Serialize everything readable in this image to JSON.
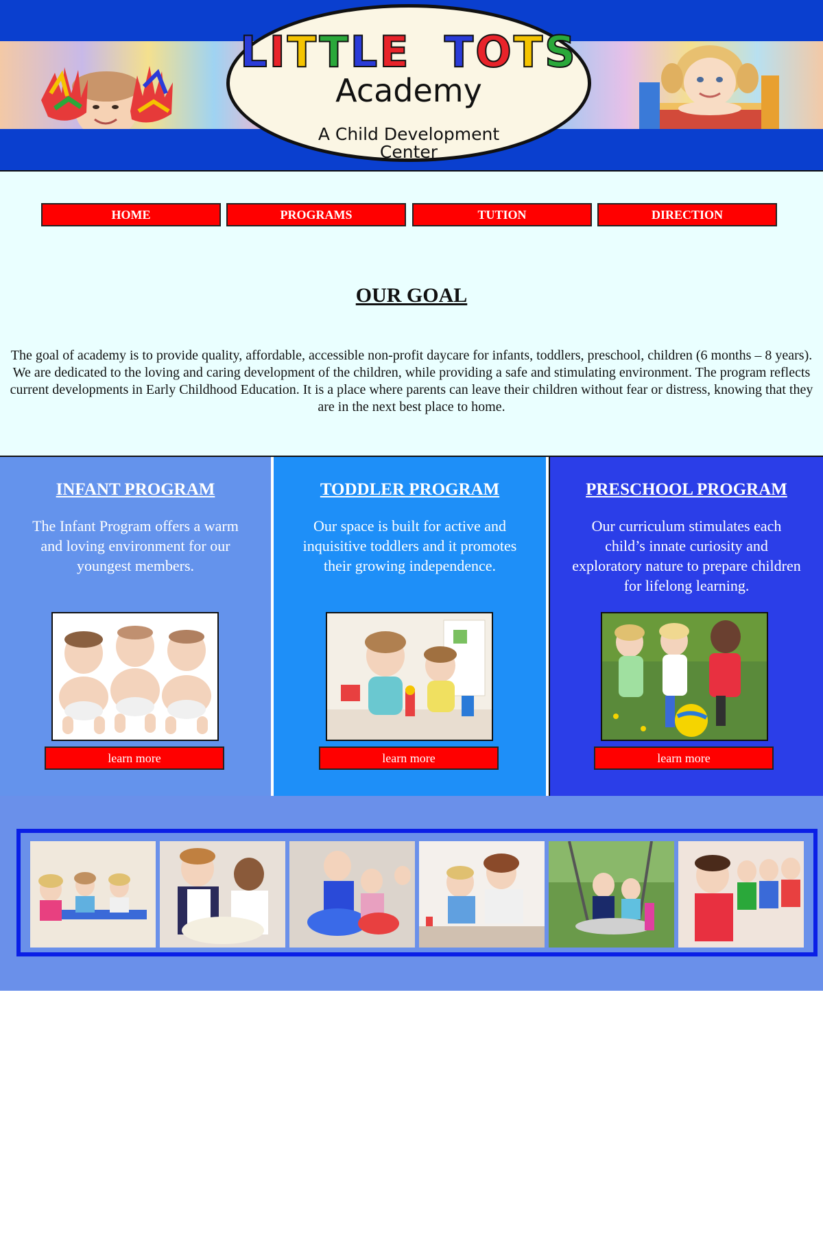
{
  "header": {
    "logo": {
      "title_letters": [
        {
          "char": "L",
          "color": "#2a3bd8"
        },
        {
          "char": "I",
          "color": "#e8232a"
        },
        {
          "char": "T",
          "color": "#f5c400"
        },
        {
          "char": "T",
          "color": "#2aa83a"
        },
        {
          "char": "L",
          "color": "#2a3bd8"
        },
        {
          "char": "E",
          "color": "#e8232a"
        },
        {
          "char": " ",
          "color": "#111111"
        },
        {
          "char": "T",
          "color": "#2a3bd8"
        },
        {
          "char": "O",
          "color": "#e8232a"
        },
        {
          "char": "T",
          "color": "#f5c400"
        },
        {
          "char": "S",
          "color": "#2aa83a"
        }
      ],
      "subtitle": "Academy",
      "tagline_line1": "A Child Development",
      "tagline_line2": "Center"
    }
  },
  "nav": {
    "items": [
      {
        "label": "HOME"
      },
      {
        "label": "PROGRAMS"
      },
      {
        "label": "TUTION"
      },
      {
        "label": "DIRECTION"
      }
    ]
  },
  "goal": {
    "title": "OUR GOAL",
    "text": "The goal of academy is to provide quality, affordable, accessible non-profit daycare for infants, toddlers, preschool, children (6 months – 8 years). We are dedicated to the loving and caring development of the children, while providing a safe and stimulating environment. The program reflects current developments in Early Childhood Education. It is a place where parents can leave their children without fear or distress, knowing that they are in the next best place to home."
  },
  "programs": [
    {
      "title": "INFANT PROGRAM",
      "description": "The Infant Program offers a warm and loving environment for our youngest members.",
      "button": "learn more",
      "bg": "#6493ec"
    },
    {
      "title": "TODDLER PROGRAM",
      "description": "Our space is built for active and inquisitive toddlers and it promotes their growing independence.",
      "button": "learn more",
      "bg": "#1e8ff8"
    },
    {
      "title": "PRESCHOOL PROGRAM",
      "description": "Our curriculum stimulates each child’s innate curiosity and exploratory nature to prepare children for lifelong learning.",
      "button": "learn more",
      "bg": "#2b3ee8"
    }
  ],
  "colors": {
    "header_blue": "#0a3fcf",
    "nav_button": "#ff0000",
    "main_bg": "#eaffff",
    "gallery_bg": "#6a90ea",
    "gallery_border": "#0a1fe6"
  }
}
